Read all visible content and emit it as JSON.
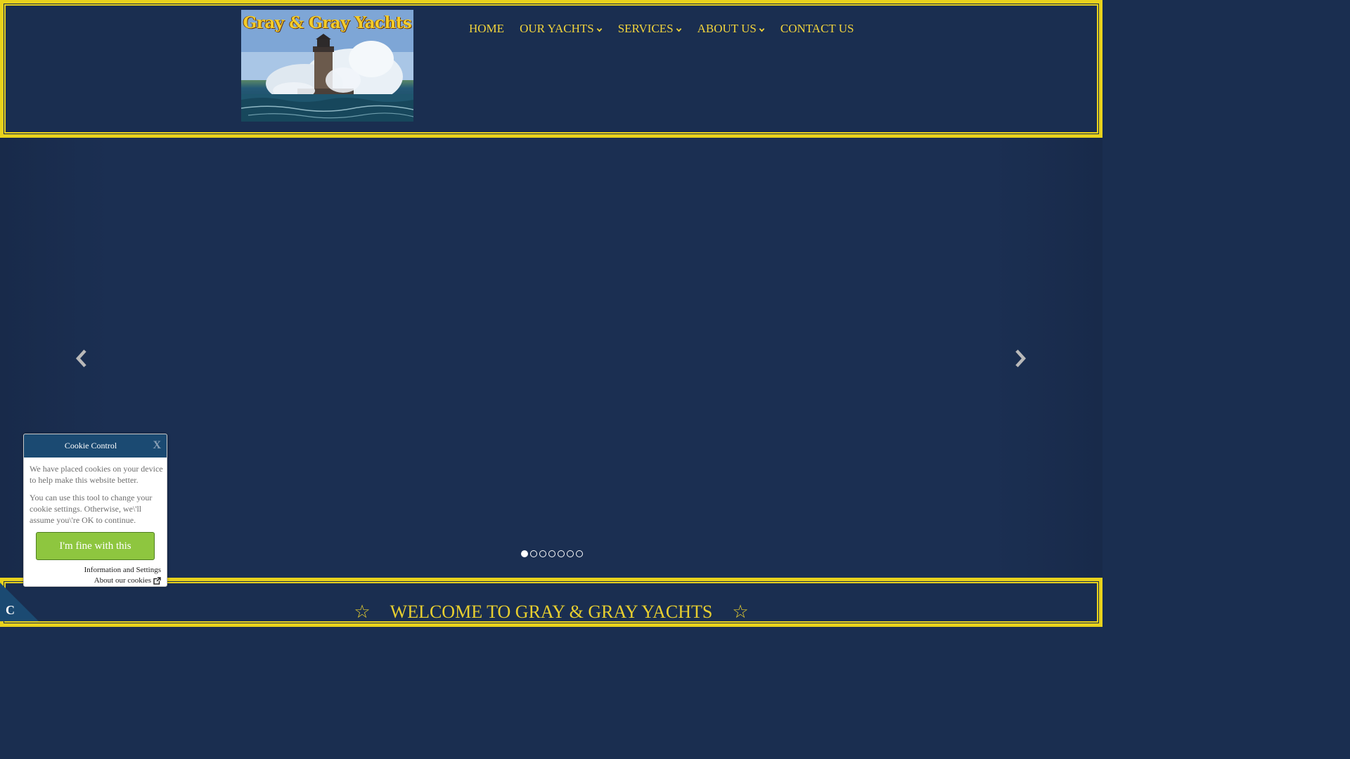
{
  "header": {
    "logo_text": "Gray & Gray Yachts"
  },
  "nav": {
    "items": [
      {
        "label": "HOME",
        "has_dropdown": false
      },
      {
        "label": "OUR YACHTS",
        "has_dropdown": true
      },
      {
        "label": "SERVICES",
        "has_dropdown": true
      },
      {
        "label": "ABOUT US",
        "has_dropdown": true
      },
      {
        "label": "CONTACT US",
        "has_dropdown": false
      }
    ]
  },
  "slider": {
    "slide_count": 7,
    "active_index": 0,
    "prev_icon": "chevron-left-icon",
    "next_icon": "chevron-right-icon"
  },
  "welcome": {
    "star": "☆",
    "title": "WELCOME TO GRAY & GRAY YACHTS"
  },
  "cookie": {
    "title": "Cookie Control",
    "close_label": "X",
    "text1": "We have placed cookies on your device to help make this website better.",
    "text2": "You can use this tool to change your cookie settings. Otherwise, we\\'ll assume you\\'re OK to continue.",
    "accept_label": "I'm fine with this",
    "info_link": "Information and Settings",
    "about_link": "About our cookies",
    "corner_letter": "C"
  },
  "colors": {
    "background": "#1a2e50",
    "accent_gold": "#e8d21c",
    "nav_text": "#f2d43c",
    "cookie_header": "#1b4a72",
    "cookie_button": "#8ec63f"
  }
}
